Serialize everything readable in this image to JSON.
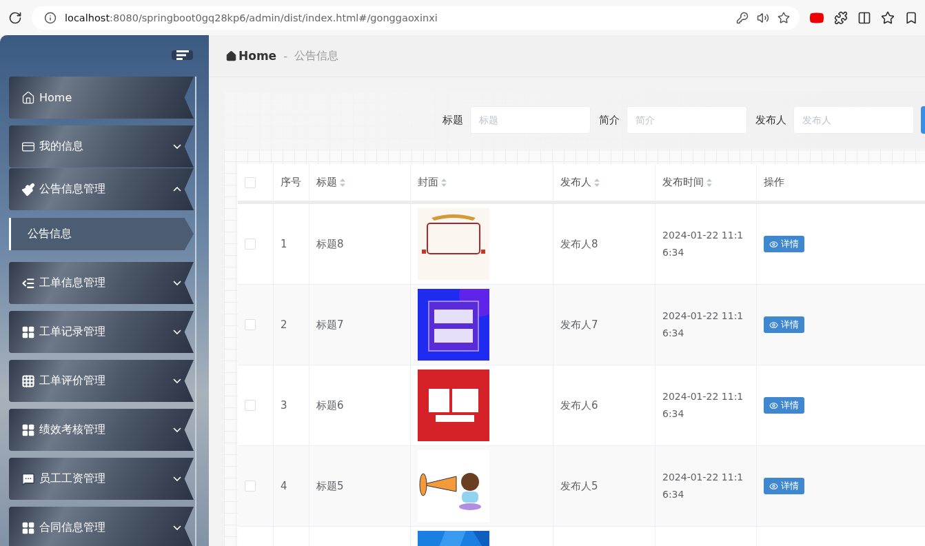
{
  "browser": {
    "url_host": "localhost",
    "url_path": ":8080/springboot0gq28kp6/admin/dist/index.html#/gonggaoxinxi"
  },
  "sidebar": {
    "items": [
      {
        "kind": "link",
        "label": "Home"
      },
      {
        "kind": "menu",
        "label": "我的信息",
        "expanded": false
      },
      {
        "kind": "menu",
        "label": "公告信息管理",
        "expanded": true,
        "children": [
          {
            "label": "公告信息",
            "selected": true
          }
        ]
      },
      {
        "kind": "menu",
        "label": "工单信息管理",
        "expanded": false
      },
      {
        "kind": "menu",
        "label": "工单记录管理",
        "expanded": false
      },
      {
        "kind": "menu",
        "label": "工单评价管理",
        "expanded": false
      },
      {
        "kind": "menu",
        "label": "绩效考核管理",
        "expanded": false
      },
      {
        "kind": "menu",
        "label": "员工工资管理",
        "expanded": false
      },
      {
        "kind": "menu",
        "label": "合同信息管理",
        "expanded": false
      }
    ]
  },
  "breadcrumb": {
    "home": "Home",
    "separator": "-",
    "current": "公告信息"
  },
  "search": {
    "fields": [
      {
        "label": "标题",
        "placeholder": "标题"
      },
      {
        "label": "简介",
        "placeholder": "简介"
      },
      {
        "label": "发布人",
        "placeholder": "发布人"
      }
    ]
  },
  "table": {
    "select_all": {
      "checked": false
    },
    "columns": [
      {
        "label": "序号",
        "sortable": false
      },
      {
        "label": "标题",
        "sortable": true
      },
      {
        "label": "封面",
        "sortable": true
      },
      {
        "label": "发布人",
        "sortable": true
      },
      {
        "label": "发布时间",
        "sortable": true
      },
      {
        "label": "操作",
        "sortable": false
      }
    ],
    "rows": [
      {
        "checked": false,
        "index": "1",
        "title": "标题8",
        "cover": {
          "kind": "picture"
        },
        "publisher": "发布人8",
        "time": "2024-01-22 11:16:34",
        "action": "详情"
      },
      {
        "checked": false,
        "index": "2",
        "title": "标题7",
        "cover": {
          "kind": "picture"
        },
        "publisher": "发布人7",
        "time": "2024-01-22 11:16:34",
        "action": "详情"
      },
      {
        "checked": false,
        "index": "3",
        "title": "标题6",
        "cover": {
          "kind": "picture"
        },
        "publisher": "发布人6",
        "time": "2024-01-22 11:16:34",
        "action": "详情"
      },
      {
        "checked": false,
        "index": "4",
        "title": "标题5",
        "cover": {
          "kind": "picture"
        },
        "publisher": "发布人5",
        "time": "2024-01-22 11:16:34",
        "action": "详情"
      },
      {
        "cover": {
          "kind": "picture"
        }
      }
    ]
  }
}
